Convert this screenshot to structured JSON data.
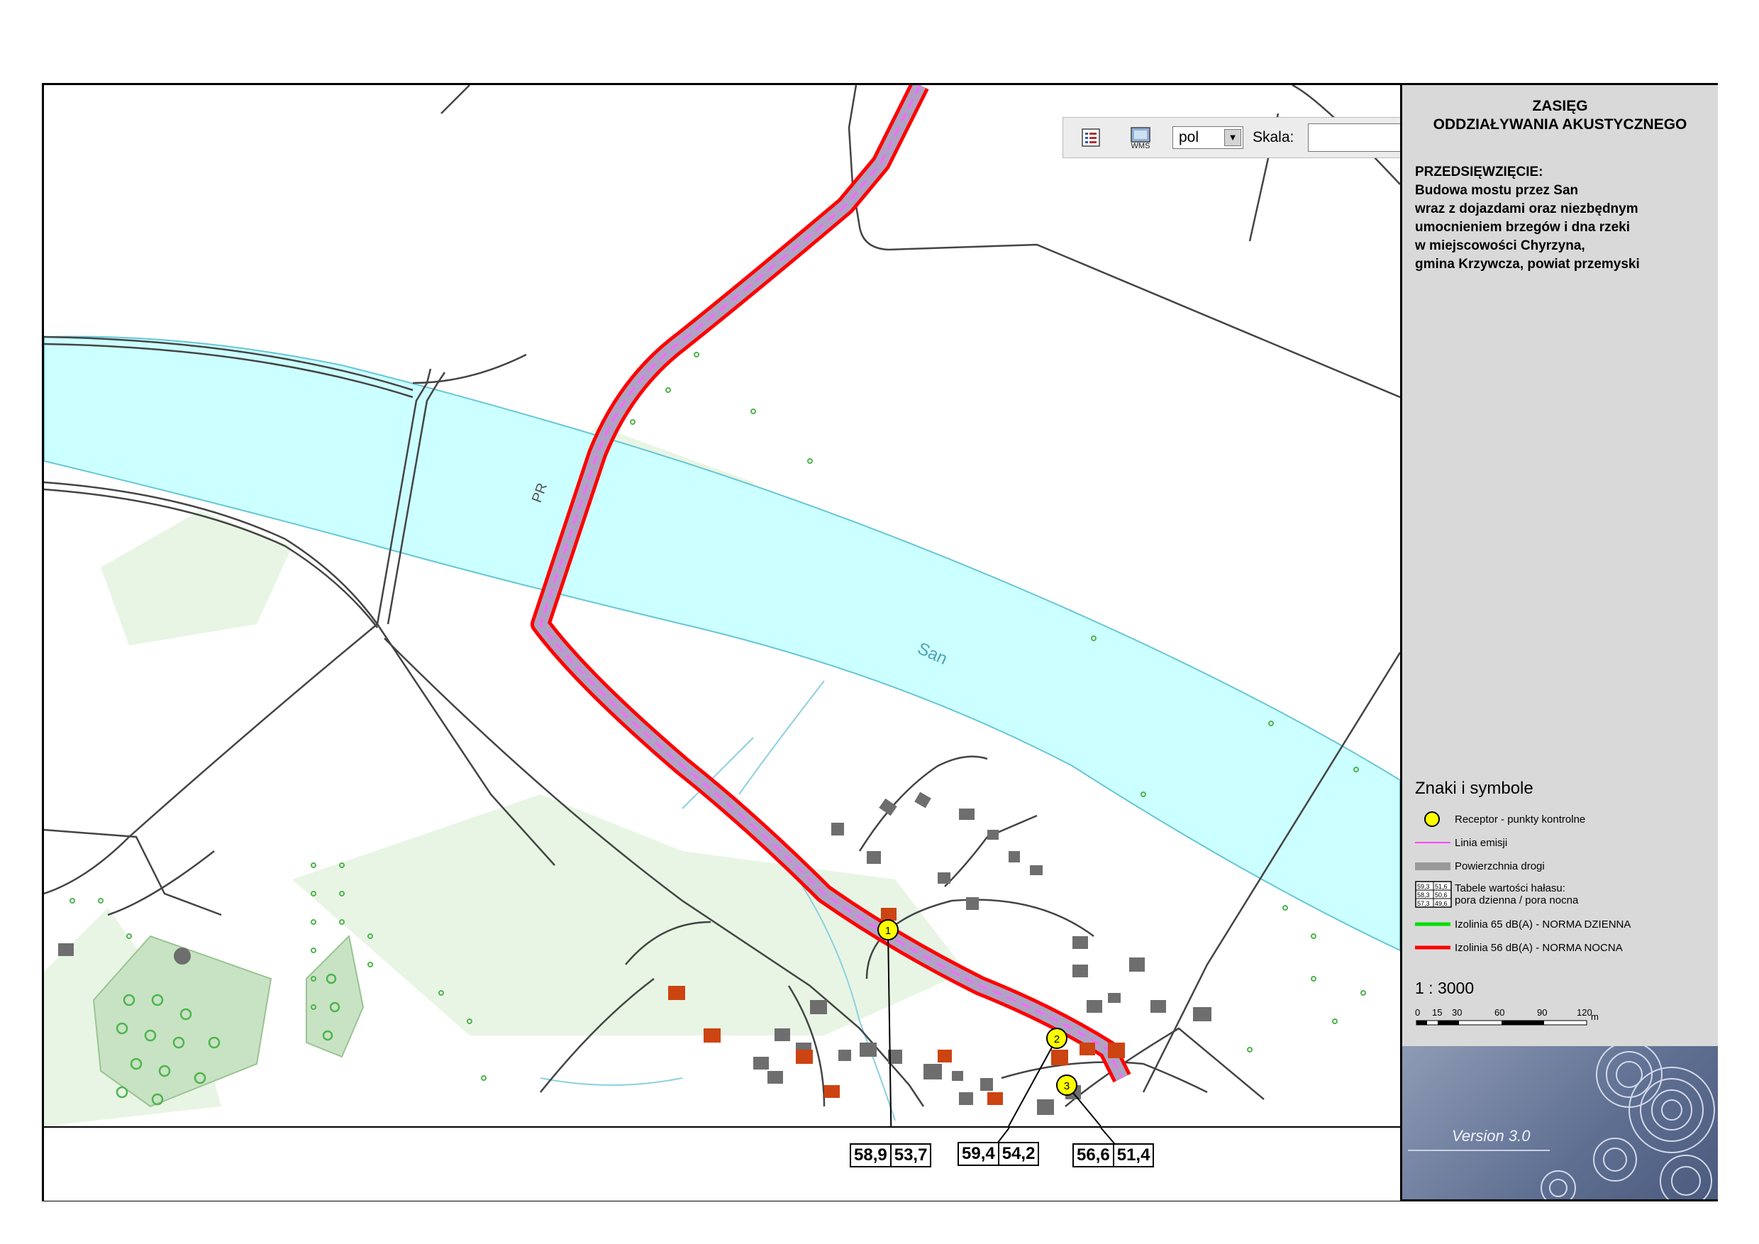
{
  "map": {
    "river_name": "San",
    "road_label": "PR",
    "receptor_labels": [
      "1",
      "2",
      "3"
    ]
  },
  "toolbar": {
    "language_value": "pol",
    "scale_label": "Skala:",
    "scale_value": ""
  },
  "receptor_values": [
    {
      "id": "1",
      "day": "58,9",
      "night": "53,7"
    },
    {
      "id": "2",
      "day": "59,4",
      "night": "54,2"
    },
    {
      "id": "3",
      "day": "56,6",
      "night": "51,4"
    }
  ],
  "panel": {
    "title_line1": "ZASIĘG",
    "title_line2": "ODDZIAŁYWANIA AKUSTYCZNEGO",
    "project_heading": "PRZEDSIĘWZIĘCIE:",
    "project_lines": [
      "Budowa mostu przez San",
      "wraz z dojazdami oraz niezbędnym",
      "umocnieniem brzegów i dna rzeki",
      "w miejscowości Chyrzyna,",
      "gmina Krzywcza, powiat przemyski"
    ],
    "legend_title": "Znaki i symbole",
    "legend": [
      {
        "icon": "receptor-circle-icon",
        "label": "Receptor - punkty kontrolne"
      },
      {
        "icon": "emission-line-icon",
        "label": "Linia emisji"
      },
      {
        "icon": "road-surface-icon",
        "label": "Powierzchnia drogi"
      },
      {
        "icon": "noise-table-icon",
        "label": "Tabele wartości hałasu:",
        "label2": "pora dzienna / pora nocna",
        "sample": [
          [
            "59,3",
            "51,6"
          ],
          [
            "58,3",
            "50,6"
          ],
          [
            "57,3",
            "49,6"
          ]
        ]
      },
      {
        "icon": "green-line-icon",
        "label": "Izolinia 65 dB(A) - NORMA DZIENNA"
      },
      {
        "icon": "red-line-icon",
        "label": "Izolinia 56 dB(A) - NORMA NOCNA"
      }
    ],
    "scale_ratio": "1 : 3000",
    "scale_ticks": [
      "0",
      "15",
      "30",
      "60",
      "90",
      "120"
    ],
    "scale_unit": "m",
    "version": "Version 3.0"
  },
  "colors": {
    "river": "#ccffff",
    "isoline_night": "#ff0000",
    "isoline_day": "#00cc00",
    "emission_line": "#cc44cc",
    "receptor": "#ffff00",
    "building_red": "#cc4411",
    "building_grey": "#777777",
    "vegetation": "#e4f3e0",
    "panel_grey": "#d9d9d9"
  }
}
